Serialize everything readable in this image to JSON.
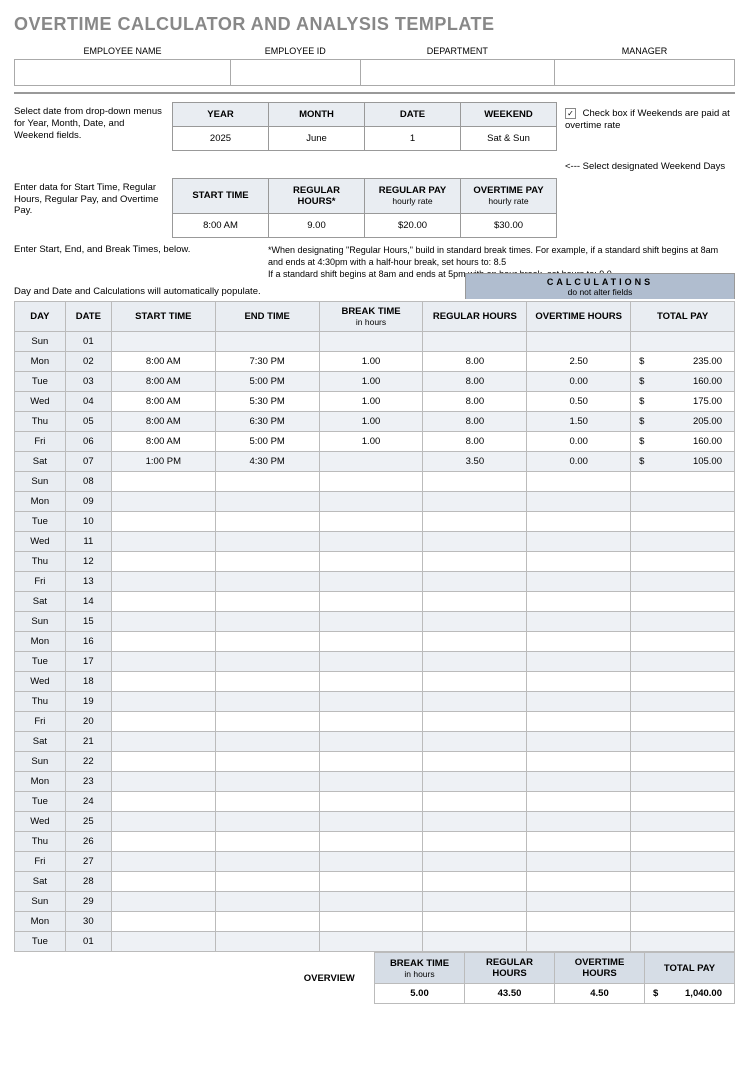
{
  "title": "OVERTIME CALCULATOR AND ANALYSIS TEMPLATE",
  "emp_headers": {
    "name": "EMPLOYEE NAME",
    "id": "EMPLOYEE ID",
    "dept": "DEPARTMENT",
    "mgr": "MANAGER"
  },
  "emp_values": {
    "name": "",
    "id": "",
    "dept": "",
    "mgr": ""
  },
  "instr1": "Select date from drop-down menus for Year, Month, Date, and Weekend fields.",
  "date_headers": {
    "year": "YEAR",
    "month": "MONTH",
    "date": "DATE",
    "weekend": "WEEKEND"
  },
  "date_values": {
    "year": "2025",
    "month": "June",
    "date": "1",
    "weekend": "Sat & Sun"
  },
  "chk_note": "Check box if Weekends are paid at overtime rate",
  "chk_checked": "✓",
  "arrow_note": "<--- Select designated Weekend Days",
  "instr2": "Enter data for Start Time, Regular Hours, Regular Pay, and Overtime Pay.",
  "rate_headers": {
    "start": "START TIME",
    "reg": "REGULAR HOURS*",
    "regpay": "REGULAR PAY",
    "regpay_sub": "hourly rate",
    "otpay": "OVERTIME PAY",
    "otpay_sub": "hourly rate"
  },
  "rate_values": {
    "start": "8:00 AM",
    "reg": "9.00",
    "regpay": "$20.00",
    "otpay": "$30.00"
  },
  "instr3": "Enter Start, End, and Break Times, below.",
  "footnote": "*When designating \"Regular Hours,\" build in standard break times. For example, if a standard shift begins at 8am and ends at 4:30pm with a half-hour break, set hours to: 8.5\nIf a standard shift begins at 8am and ends at 5pm with an hour break, set hours to: 9.0",
  "autopop": "Day and Date and Calculations will automatically populate.",
  "calc_banner": {
    "title": "CALCULATIONS",
    "sub": "do not alter fields"
  },
  "main_headers": {
    "day": "DAY",
    "date": "DATE",
    "start": "START TIME",
    "end": "END TIME",
    "break": "BREAK TIME",
    "break_sub": "in hours",
    "reg": "REGULAR HOURS",
    "ot": "OVERTIME HOURS",
    "pay": "TOTAL PAY"
  },
  "rows": [
    {
      "day": "Sun",
      "date": "01",
      "start": "",
      "end": "",
      "break": "",
      "reg": "",
      "ot": "",
      "cur": "",
      "pay": ""
    },
    {
      "day": "Mon",
      "date": "02",
      "start": "8:00 AM",
      "end": "7:30 PM",
      "break": "1.00",
      "reg": "8.00",
      "ot": "2.50",
      "cur": "$",
      "pay": "235.00"
    },
    {
      "day": "Tue",
      "date": "03",
      "start": "8:00 AM",
      "end": "5:00 PM",
      "break": "1.00",
      "reg": "8.00",
      "ot": "0.00",
      "cur": "$",
      "pay": "160.00"
    },
    {
      "day": "Wed",
      "date": "04",
      "start": "8:00 AM",
      "end": "5:30 PM",
      "break": "1.00",
      "reg": "8.00",
      "ot": "0.50",
      "cur": "$",
      "pay": "175.00"
    },
    {
      "day": "Thu",
      "date": "05",
      "start": "8:00 AM",
      "end": "6:30 PM",
      "break": "1.00",
      "reg": "8.00",
      "ot": "1.50",
      "cur": "$",
      "pay": "205.00"
    },
    {
      "day": "Fri",
      "date": "06",
      "start": "8:00 AM",
      "end": "5:00 PM",
      "break": "1.00",
      "reg": "8.00",
      "ot": "0.00",
      "cur": "$",
      "pay": "160.00"
    },
    {
      "day": "Sat",
      "date": "07",
      "start": "1:00 PM",
      "end": "4:30 PM",
      "break": "",
      "reg": "3.50",
      "ot": "0.00",
      "cur": "$",
      "pay": "105.00"
    },
    {
      "day": "Sun",
      "date": "08",
      "start": "",
      "end": "",
      "break": "",
      "reg": "",
      "ot": "",
      "cur": "",
      "pay": ""
    },
    {
      "day": "Mon",
      "date": "09",
      "start": "",
      "end": "",
      "break": "",
      "reg": "",
      "ot": "",
      "cur": "",
      "pay": ""
    },
    {
      "day": "Tue",
      "date": "10",
      "start": "",
      "end": "",
      "break": "",
      "reg": "",
      "ot": "",
      "cur": "",
      "pay": ""
    },
    {
      "day": "Wed",
      "date": "11",
      "start": "",
      "end": "",
      "break": "",
      "reg": "",
      "ot": "",
      "cur": "",
      "pay": ""
    },
    {
      "day": "Thu",
      "date": "12",
      "start": "",
      "end": "",
      "break": "",
      "reg": "",
      "ot": "",
      "cur": "",
      "pay": ""
    },
    {
      "day": "Fri",
      "date": "13",
      "start": "",
      "end": "",
      "break": "",
      "reg": "",
      "ot": "",
      "cur": "",
      "pay": ""
    },
    {
      "day": "Sat",
      "date": "14",
      "start": "",
      "end": "",
      "break": "",
      "reg": "",
      "ot": "",
      "cur": "",
      "pay": ""
    },
    {
      "day": "Sun",
      "date": "15",
      "start": "",
      "end": "",
      "break": "",
      "reg": "",
      "ot": "",
      "cur": "",
      "pay": ""
    },
    {
      "day": "Mon",
      "date": "16",
      "start": "",
      "end": "",
      "break": "",
      "reg": "",
      "ot": "",
      "cur": "",
      "pay": ""
    },
    {
      "day": "Tue",
      "date": "17",
      "start": "",
      "end": "",
      "break": "",
      "reg": "",
      "ot": "",
      "cur": "",
      "pay": ""
    },
    {
      "day": "Wed",
      "date": "18",
      "start": "",
      "end": "",
      "break": "",
      "reg": "",
      "ot": "",
      "cur": "",
      "pay": ""
    },
    {
      "day": "Thu",
      "date": "19",
      "start": "",
      "end": "",
      "break": "",
      "reg": "",
      "ot": "",
      "cur": "",
      "pay": ""
    },
    {
      "day": "Fri",
      "date": "20",
      "start": "",
      "end": "",
      "break": "",
      "reg": "",
      "ot": "",
      "cur": "",
      "pay": ""
    },
    {
      "day": "Sat",
      "date": "21",
      "start": "",
      "end": "",
      "break": "",
      "reg": "",
      "ot": "",
      "cur": "",
      "pay": ""
    },
    {
      "day": "Sun",
      "date": "22",
      "start": "",
      "end": "",
      "break": "",
      "reg": "",
      "ot": "",
      "cur": "",
      "pay": ""
    },
    {
      "day": "Mon",
      "date": "23",
      "start": "",
      "end": "",
      "break": "",
      "reg": "",
      "ot": "",
      "cur": "",
      "pay": ""
    },
    {
      "day": "Tue",
      "date": "24",
      "start": "",
      "end": "",
      "break": "",
      "reg": "",
      "ot": "",
      "cur": "",
      "pay": ""
    },
    {
      "day": "Wed",
      "date": "25",
      "start": "",
      "end": "",
      "break": "",
      "reg": "",
      "ot": "",
      "cur": "",
      "pay": ""
    },
    {
      "day": "Thu",
      "date": "26",
      "start": "",
      "end": "",
      "break": "",
      "reg": "",
      "ot": "",
      "cur": "",
      "pay": ""
    },
    {
      "day": "Fri",
      "date": "27",
      "start": "",
      "end": "",
      "break": "",
      "reg": "",
      "ot": "",
      "cur": "",
      "pay": ""
    },
    {
      "day": "Sat",
      "date": "28",
      "start": "",
      "end": "",
      "break": "",
      "reg": "",
      "ot": "",
      "cur": "",
      "pay": ""
    },
    {
      "day": "Sun",
      "date": "29",
      "start": "",
      "end": "",
      "break": "",
      "reg": "",
      "ot": "",
      "cur": "",
      "pay": ""
    },
    {
      "day": "Mon",
      "date": "30",
      "start": "",
      "end": "",
      "break": "",
      "reg": "",
      "ot": "",
      "cur": "",
      "pay": ""
    },
    {
      "day": "Tue",
      "date": "01",
      "start": "",
      "end": "",
      "break": "",
      "reg": "",
      "ot": "",
      "cur": "",
      "pay": ""
    }
  ],
  "overview": {
    "label": "OVERVIEW",
    "break": "5.00",
    "reg": "43.50",
    "ot": "4.50",
    "cur": "$",
    "pay": "1,040.00"
  }
}
